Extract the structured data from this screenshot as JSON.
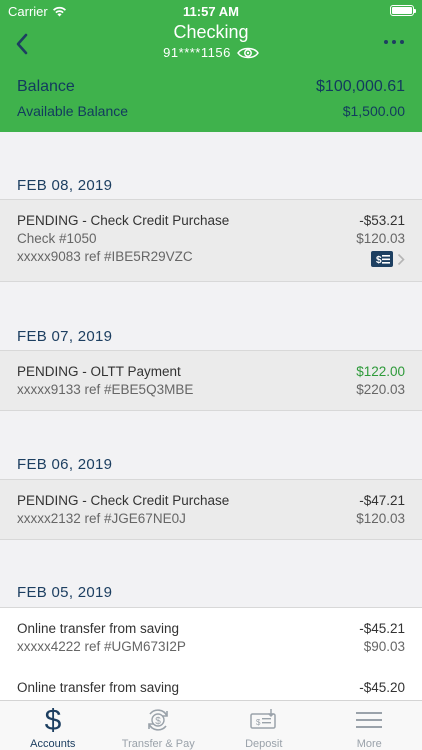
{
  "status_bar": {
    "carrier": "Carrier",
    "time": "11:57 AM"
  },
  "header": {
    "title": "Checking",
    "account_number": "91****1156",
    "balance_label": "Balance",
    "balance_value": "$100,000.61",
    "available_label": "Available Balance",
    "available_value": "$1,500.00"
  },
  "groups": [
    {
      "date": "FEB 08, 2019",
      "transactions": [
        {
          "description": "PENDING - Check Credit Purchase",
          "check": "Check #1050",
          "ref": "xxxxx9083 ref #IBE5R29VZC",
          "amount": "-$53.21",
          "balance": "$120.03",
          "has_check_image": true
        }
      ]
    },
    {
      "date": "FEB 07, 2019",
      "transactions": [
        {
          "description": "PENDING - OLTT Payment",
          "ref": "xxxxx9133 ref #EBE5Q3MBE",
          "amount": "$122.00",
          "balance": "$220.03"
        }
      ]
    },
    {
      "date": "FEB 06, 2019",
      "transactions": [
        {
          "description": "PENDING - Check Credit Purchase",
          "ref": "xxxxx2132 ref #JGE67NE0J",
          "amount": "-$47.21",
          "balance": "$120.03"
        }
      ]
    },
    {
      "date": "FEB 05, 2019",
      "transactions": [
        {
          "description": "Online transfer from saving",
          "ref": "xxxxx4222 ref #UGM673I2P",
          "amount": "-$45.21",
          "balance": "$90.03"
        },
        {
          "description": "Online transfer from saving",
          "amount": "-$45.20"
        }
      ]
    }
  ],
  "tabs": [
    {
      "label": "Accounts",
      "icon": "dollar-icon",
      "active": true
    },
    {
      "label": "Transfer & Pay",
      "icon": "transfer-icon",
      "active": false
    },
    {
      "label": "Deposit",
      "icon": "check-deposit-icon",
      "active": false
    },
    {
      "label": "More",
      "icon": "menu-icon",
      "active": false
    }
  ],
  "colors": {
    "brand_green": "#3fb24c",
    "navy": "#1d3f61",
    "positive_amount": "#2e9a3a",
    "tab_inactive": "#9aa2aa"
  }
}
